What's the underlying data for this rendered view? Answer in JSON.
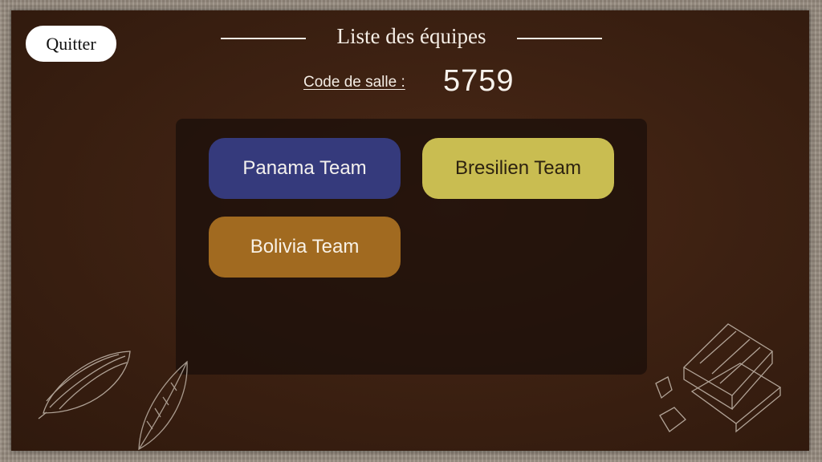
{
  "header": {
    "quit_label": "Quitter",
    "title": "Liste des équipes",
    "room_code_label": "Code de salle :",
    "room_code_value": "5759"
  },
  "teams": [
    {
      "label": "Panama Team",
      "color": "#353a7c"
    },
    {
      "label": "Bresilien Team",
      "color": "#c9bd51"
    },
    {
      "label": "Bolivia Team",
      "color": "#a16a20"
    }
  ],
  "decorations": [
    "cocoa-pod-icon",
    "leaf-icon",
    "chocolate-pieces-icon"
  ],
  "colors": {
    "board": "#3d2112",
    "panel": "#1e100a",
    "text": "#f5eee6"
  }
}
